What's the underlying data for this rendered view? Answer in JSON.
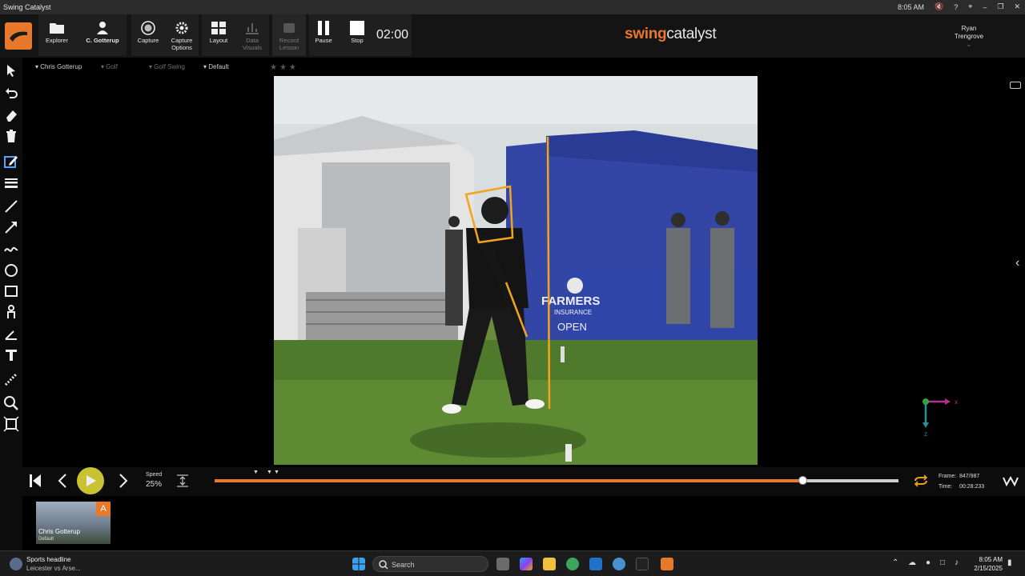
{
  "window": {
    "title": "Swing Catalyst",
    "clock": "8:05 AM",
    "controls": [
      "mute-icon",
      "help-icon",
      "fit-icon",
      "minimize-icon",
      "restore-icon",
      "close-icon"
    ]
  },
  "toolbar": {
    "explorer": "Explorer",
    "user_button": "C. Gotterup",
    "capture": "Capture",
    "capture_options": "Capture Options",
    "layout": "Layout",
    "data_visuals": "Data Visuals",
    "record_lesson": "Record Lesson",
    "pause": "Pause",
    "stop": "Stop",
    "timer": "02:00",
    "brand_prefix": "swing",
    "brand_suffix": "catalyst",
    "user_first": "Ryan",
    "user_last": "Trengrove"
  },
  "breadcrumb": {
    "player": "Chris Gotterup",
    "sport": "Golf",
    "activity": "Golf Swing",
    "layout": "Default"
  },
  "transport": {
    "speed_label": "Speed",
    "speed_value": "25%",
    "progress": 0.86,
    "frame_label": "Frame:",
    "frame_value": "847/987",
    "time_label": "Time:",
    "time_value": "00:28:233"
  },
  "axes": {
    "x": "x",
    "y": "y",
    "z": "z"
  },
  "thumbnail": {
    "badge": "A",
    "title": "Chris Gotterup",
    "subtitle": "Default"
  },
  "taskbar": {
    "news_title": "Sports headline",
    "news_text": "Leicester vs Arse...",
    "search_placeholder": "Search",
    "time": "8:05 AM",
    "date": "2/15/2025"
  },
  "colors": {
    "accent": "#e8782a",
    "background": "#000000",
    "toolbar": "#141414"
  }
}
